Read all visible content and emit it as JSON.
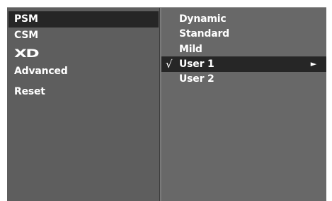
{
  "left_menu": {
    "items": [
      {
        "label": "PSM",
        "selected": true
      },
      {
        "label": "CSM",
        "selected": false
      },
      {
        "label": "XD",
        "selected": false,
        "is_logo": true
      },
      {
        "label": "Advanced",
        "selected": false
      },
      {
        "label": "Reset",
        "selected": false
      }
    ]
  },
  "right_menu": {
    "items": [
      {
        "label": "Dynamic",
        "checked": false,
        "selected": false
      },
      {
        "label": "Standard",
        "checked": false,
        "selected": false
      },
      {
        "label": "Mild",
        "checked": false,
        "selected": false
      },
      {
        "label": "User 1",
        "checked": true,
        "selected": true,
        "check_mark": "√",
        "arrow": "►"
      },
      {
        "label": "User 2",
        "checked": false,
        "selected": false
      }
    ]
  },
  "colors": {
    "background": "#686868",
    "left_panel": "#5e5e5e",
    "highlight": "#262626",
    "text": "#ffffff"
  }
}
